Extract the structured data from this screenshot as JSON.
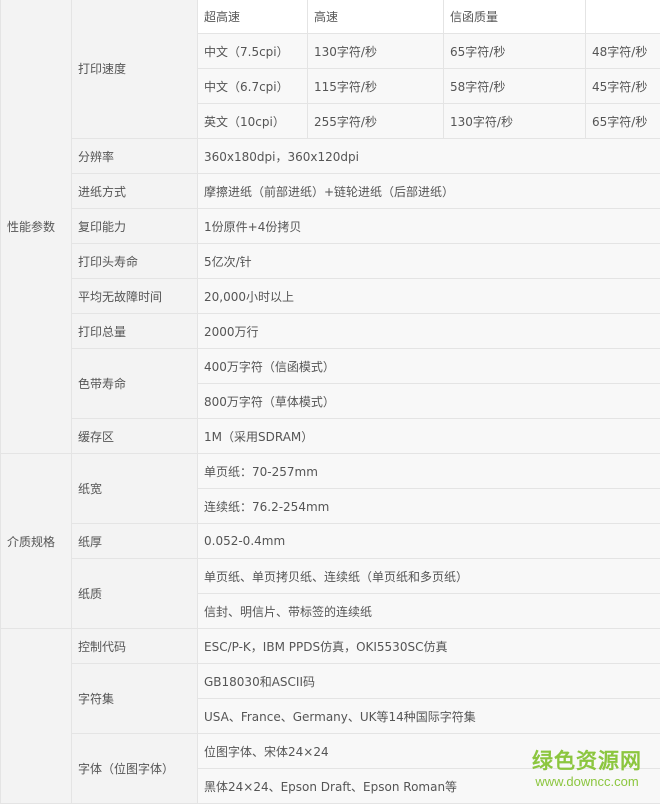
{
  "categories": {
    "performance": "性能参数",
    "media": "介质规格",
    "other": ""
  },
  "speed": {
    "label": "打印速度",
    "header": [
      "超高速",
      "高速",
      "信函质量",
      ""
    ],
    "rows": [
      [
        "中文（7.5cpi）",
        "130字符/秒",
        "65字符/秒",
        "48字符/秒"
      ],
      [
        "中文（6.7cpi）",
        "115字符/秒",
        "58字符/秒",
        "45字符/秒"
      ],
      [
        "英文（10cpi）",
        "255字符/秒",
        "130字符/秒",
        "65字符/秒"
      ]
    ]
  },
  "performance_rows": [
    {
      "label": "分辨率",
      "value": "360x180dpi，360x120dpi"
    },
    {
      "label": "进纸方式",
      "value": "摩擦进纸（前部进纸）+链轮进纸（后部进纸）"
    },
    {
      "label": "复印能力",
      "value": "1份原件+4份拷贝"
    },
    {
      "label": "打印头寿命",
      "value": "5亿次/针"
    },
    {
      "label": "平均无故障时间",
      "value": "20,000小时以上"
    },
    {
      "label": "打印总量",
      "value": "2000万行"
    }
  ],
  "ribbon": {
    "label": "色带寿命",
    "values": [
      "400万字符（信函模式）",
      "800万字符（草体模式）"
    ]
  },
  "buffer": {
    "label": "缓存区",
    "value": "1M（采用SDRAM）"
  },
  "paper_width": {
    "label": "纸宽",
    "values": [
      "单页纸：70-257mm",
      "连续纸：76.2-254mm"
    ]
  },
  "paper_thickness": {
    "label": "纸厚",
    "value": "0.052-0.4mm"
  },
  "paper_quality": {
    "label": "纸质",
    "values": [
      "单页纸、单页拷贝纸、连续纸（单页纸和多页纸）",
      "信封、明信片、带标签的连续纸"
    ]
  },
  "control_code": {
    "label": "控制代码",
    "value": "ESC/P-K，IBM  PPDS仿真，OKI5530SC仿真"
  },
  "charset": {
    "label": "字符集",
    "values": [
      "GB18030和ASCII码",
      "USA、France、Germany、UK等14种国际字符集"
    ]
  },
  "font": {
    "label": "字体（位图字体）",
    "values": [
      "位图字体、宋体24×24",
      "黑体24×24、Epson  Draft、Epson Roman等"
    ]
  },
  "watermark": {
    "title": "绿色资源网",
    "url": "www.downcc.com"
  }
}
